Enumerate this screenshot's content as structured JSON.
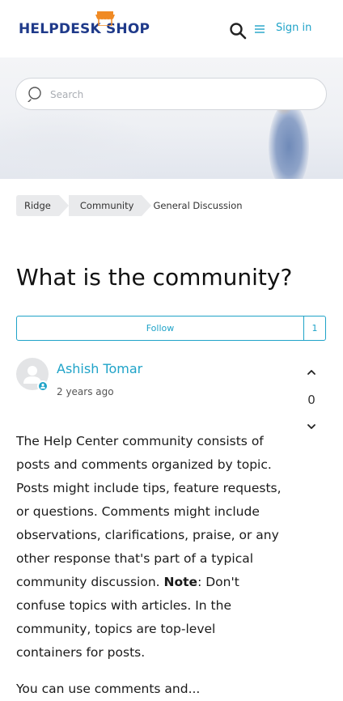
{
  "header": {
    "logo_text": "HELPDESK SHOP",
    "signin_label": "Sign in",
    "search_icon": "search-icon",
    "menu_icon": "hamburger-menu-icon",
    "accent": "#1fa3c8",
    "brand": "#1f3a8a",
    "logo_accent": "#f08a24"
  },
  "search": {
    "placeholder": "Search"
  },
  "breadcrumb": {
    "items": [
      "Ridge",
      "Community"
    ],
    "current": "General Discussion"
  },
  "post": {
    "title": "What is the community?",
    "follow_label": "Follow",
    "follow_count": "1",
    "author": "Ashish Tomar",
    "date": "2 years ago",
    "vote_count": "0",
    "body_p1_part1": "The Help Center community consists of posts and comments organized by topic. Posts might include tips, feature requests, or questions. Comments might include observations, clarifications, praise, or any other response that's part of a typical community discussion. ",
    "body_p1_bold": "Note",
    "body_p1_part2": ": Don't confuse topics with articles. In the community, topics are top-level containers for posts.",
    "body_p2": "You can use comments and..."
  }
}
